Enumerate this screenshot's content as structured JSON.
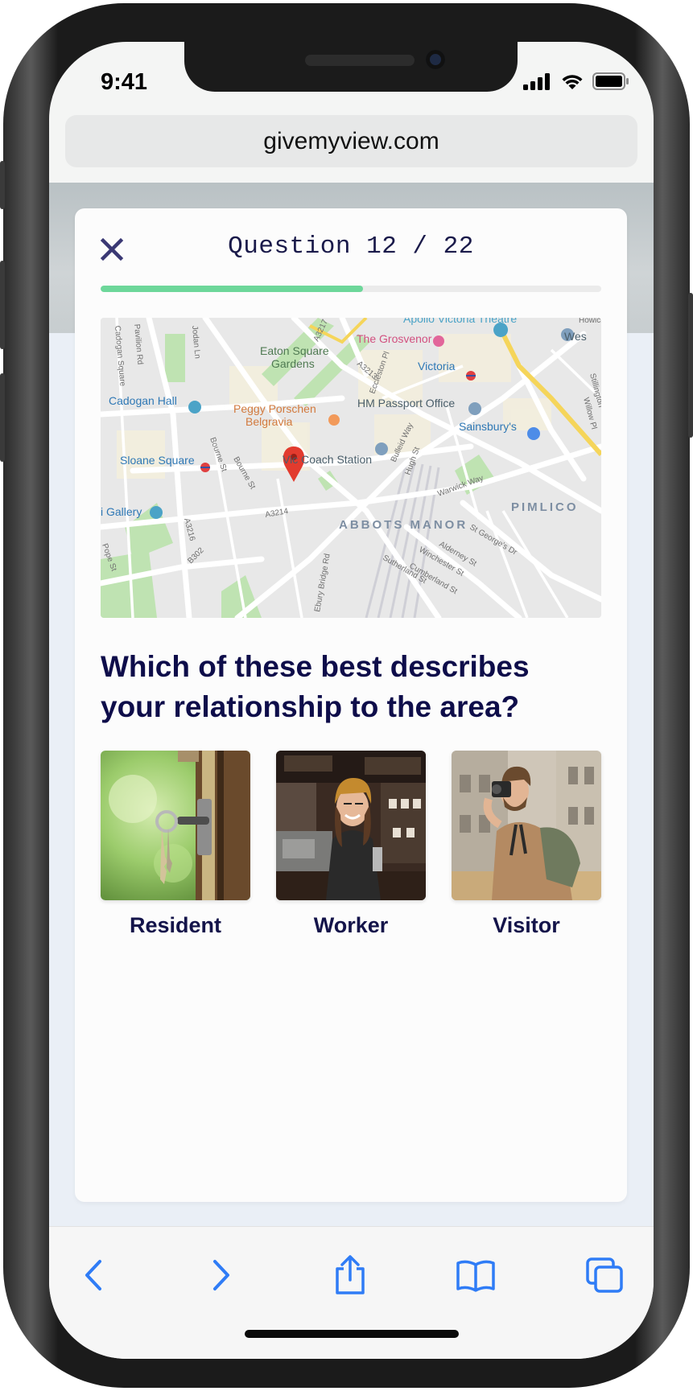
{
  "status_bar": {
    "time": "9:41"
  },
  "browser": {
    "url": "givemyview.com"
  },
  "survey": {
    "question_counter": "Question 12 / 22",
    "progress": 0.524,
    "question": "Which of these best describes your relationship to the area?",
    "options": [
      {
        "label": "Resident"
      },
      {
        "label": "Worker"
      },
      {
        "label": "Visitor"
      }
    ]
  },
  "map": {
    "labels": {
      "apollo": "Apollo Victoria Theatre",
      "grosvenor": "The Grosvenor",
      "eaton_1": "Eaton Square",
      "eaton_2": "Gardens",
      "victoria": "Victoria",
      "cadogan": "Cadogan Hall",
      "peggy_1": "Peggy Porschen",
      "peggy_2": "Belgravia",
      "hm": "HM Passport Office",
      "sainsburys": "Sainsbury's",
      "sloane": "Sloane Square",
      "coach": "Vic     Coach Station",
      "gallery": "i Gallery",
      "abbots": "ABBOTS MANOR",
      "pimlico": "PIMLICO",
      "wes": "Wes",
      "a3214": "A3214",
      "a3216": "A3216",
      "a3213": "A3213",
      "a3217": "A3217",
      "b302": "B302",
      "cadogan_sq": "Cadogan Square",
      "pavilion": "Pavilion Rd",
      "ebury": "Ebury Bridge Rd",
      "sutherland": "Sutherland St",
      "cumberland": "Cumberland St",
      "winchester": "Winchester St",
      "alderney": "Alderney St",
      "stgeorges": "St George's Dr",
      "warwick": "Warwick Way",
      "hugh": "Hugh St",
      "bourne1": "Bourne St",
      "bourne2": "Bourne St",
      "eccleston": "Eccleston Pl",
      "buckland": "Bulleid Way",
      "willow": "Willow Pl",
      "stilling": "Stillington",
      "howick": "Howick",
      "jodan": "Jodan Ln",
      "pope": "Pope St"
    }
  },
  "colors": {
    "accent_progress": "#6dd79a",
    "navy_text": "#0e0d4a",
    "ios_blue": "#2f7cf6"
  }
}
